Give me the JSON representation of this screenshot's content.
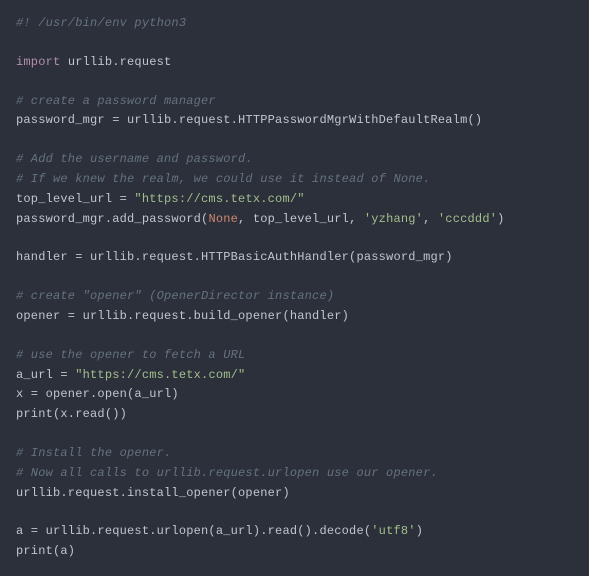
{
  "code": {
    "l1": "#! /usr/bin/env python3",
    "l2": "import",
    "l2b": " urllib.request",
    "l3": "# create a password manager",
    "l4": "password_mgr = urllib.request.HTTPPasswordMgrWithDefaultRealm()",
    "l5": "# Add the username and password.",
    "l6": "# If we knew the realm, we could use it instead of None.",
    "l7a": "top_level_url = ",
    "l7b": "\"https://cms.tetx.com/\"",
    "l8a": "password_mgr.add_password(",
    "l8b": "None",
    "l8c": ", top_level_url, ",
    "l8d": "'yzhang'",
    "l8e": ", ",
    "l8f": "'cccddd'",
    "l8g": ")",
    "l9": "handler = urllib.request.HTTPBasicAuthHandler(password_mgr)",
    "l10": "# create \"opener\" (OpenerDirector instance)",
    "l11": "opener = urllib.request.build_opener(handler)",
    "l12": "# use the opener to fetch a URL",
    "l13a": "a_url = ",
    "l13b": "\"https://cms.tetx.com/\"",
    "l14": "x = opener.open(a_url)",
    "l15": "print(x.read())",
    "l16": "# Install the opener.",
    "l17": "# Now all calls to urllib.request.urlopen use our opener.",
    "l18": "urllib.request.install_opener(opener)",
    "l19a": "a = urllib.request.urlopen(a_url).read().decode(",
    "l19b": "'utf8'",
    "l19c": ")",
    "l20": "print(a)"
  }
}
